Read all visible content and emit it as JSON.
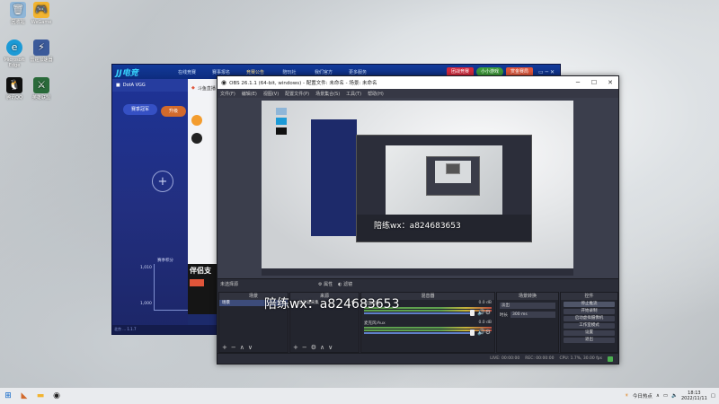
{
  "desktop": {
    "icons": [
      {
        "label": "回收站",
        "glyph": "🗑",
        "color": "#8fb6d8"
      },
      {
        "label": "WeGame",
        "glyph": "🎮",
        "color": "#f2b430"
      },
      {
        "label": "Microsoft Edge",
        "glyph": "e",
        "color": "#1c9ad6"
      },
      {
        "label": "雷霆加速器",
        "glyph": "⚡",
        "color": "#3b5a9a"
      },
      {
        "label": "腾讯QQ",
        "glyph": "🐧",
        "color": "#111111"
      },
      {
        "label": "英雄联盟",
        "glyph": "⚔",
        "color": "#2a6a3a"
      }
    ]
  },
  "game_window": {
    "logo": "JJ电竞",
    "nav": [
      "在线竞赛",
      "赛事报名",
      "竞赛公告",
      "陪玩社",
      "我们官方",
      "更多服务"
    ],
    "active_nav": "竞赛公告",
    "buttons": [
      {
        "label": "团战竞赛",
        "color": "#d4283c"
      },
      {
        "label": "小小游戏",
        "color": "#3d9a39"
      },
      {
        "label": "赏金赛局",
        "color": "#e0553a"
      }
    ],
    "tab_label": "DotA VGG",
    "tab2_label": "斗鱼直播",
    "promo_title": "赛季冠军",
    "promo_tag": "升级",
    "chart_ticks": [
      "1,010",
      "1,000"
    ],
    "chart_label": "赛季积分",
    "card_text": "伴侣支",
    "status": "北京 ... 1.1.7"
  },
  "obs": {
    "title": "OBS 26.1.1 (64-bit, windows) - 配置文件: 未命名 - 场景: 未命名",
    "menu": [
      "文件(F)",
      "编辑(E)",
      "视图(V)",
      "配置文件(P)",
      "场景集合(S)",
      "工具(T)",
      "帮助(H)"
    ],
    "preview_watermark": "陪练wx：a824683653",
    "no_source_label": "未选择源",
    "props_label": "属性",
    "filters_label": "滤镜",
    "docks": {
      "scenes": {
        "header": "场景",
        "item": "场景"
      },
      "sources": {
        "header": "来源",
        "item": "显示器采集"
      },
      "mixer": {
        "header": "混音器",
        "channels": [
          {
            "name": "桌面音频",
            "db": "0.0 dB"
          },
          {
            "name": "麦克风/Aux",
            "db": "0.0 dB"
          }
        ]
      },
      "transitions": {
        "header": "场景转换",
        "type": "淡出",
        "duration_label": "时长",
        "duration": "300 ms"
      },
      "controls": {
        "header": "控件",
        "buttons": [
          "停止推流",
          "开始录制",
          "启动虚拟摄像机",
          "工作室模式",
          "设置",
          "退出"
        ],
        "selected": "停止推流"
      }
    },
    "dock_watermark": "陪练wx：a824683653",
    "status": {
      "live": "LIVE: 00:00:00",
      "rec": "REC: 00:00:00",
      "cpu": "CPU: 1.7%, 30.00 fps"
    }
  },
  "taskbar": {
    "weather": "今日热点",
    "time": "18:13",
    "date": "2022/11/11"
  }
}
